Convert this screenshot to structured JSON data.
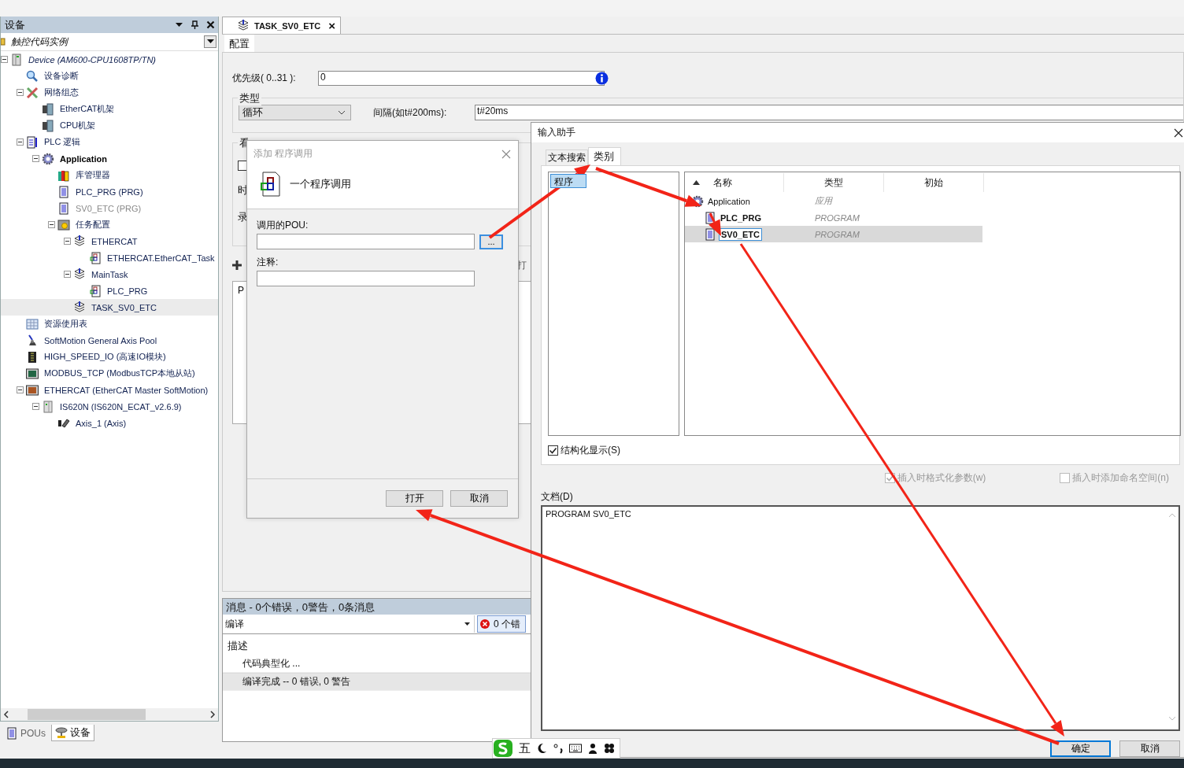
{
  "device_panel": {
    "title": "设备",
    "project": "触控代码实例",
    "tree": [
      {
        "text": "Device (AM600-CPU1608TP/TN)",
        "kind": "device",
        "italic": true,
        "bold": false,
        "greyed": false,
        "selected": false,
        "expanded": true,
        "children": [
          {
            "text": "设备诊断",
            "kind": "diag",
            "italic": false,
            "bold": false,
            "greyed": false,
            "selected": false
          },
          {
            "text": "网络组态",
            "kind": "network",
            "italic": false,
            "bold": false,
            "greyed": false,
            "selected": false,
            "expanded": true,
            "children": [
              {
                "text": "EtherCAT机架",
                "kind": "rack",
                "italic": false,
                "bold": false,
                "greyed": false,
                "selected": false
              },
              {
                "text": "CPU机架",
                "kind": "rack",
                "italic": false,
                "bold": false,
                "greyed": false,
                "selected": false
              }
            ]
          },
          {
            "text": "PLC 逻辑",
            "kind": "plc",
            "italic": false,
            "bold": false,
            "greyed": false,
            "selected": false,
            "expanded": true,
            "children": [
              {
                "text": "Application",
                "kind": "application",
                "italic": false,
                "bold": true,
                "greyed": false,
                "selected": false,
                "expanded": true,
                "children": [
                  {
                    "text": "库管理器",
                    "kind": "library",
                    "italic": false,
                    "bold": false,
                    "greyed": false,
                    "selected": false
                  },
                  {
                    "text": "PLC_PRG (PRG)",
                    "kind": "pou",
                    "italic": false,
                    "bold": false,
                    "greyed": false,
                    "selected": false
                  },
                  {
                    "text": "SV0_ETC (PRG)",
                    "kind": "pou",
                    "italic": false,
                    "bold": false,
                    "greyed": true,
                    "selected": false
                  },
                  {
                    "text": "任务配置",
                    "kind": "taskconfig",
                    "italic": false,
                    "bold": false,
                    "greyed": false,
                    "selected": false,
                    "expanded": true,
                    "children": [
                      {
                        "text": "ETHERCAT",
                        "kind": "task",
                        "italic": false,
                        "bold": false,
                        "greyed": false,
                        "selected": false,
                        "expanded": true,
                        "children": [
                          {
                            "text": "ETHERCAT.EtherCAT_Task",
                            "kind": "call",
                            "italic": false,
                            "bold": false,
                            "greyed": false,
                            "selected": false
                          }
                        ]
                      },
                      {
                        "text": "MainTask",
                        "kind": "task",
                        "italic": false,
                        "bold": false,
                        "greyed": false,
                        "selected": false,
                        "expanded": true,
                        "children": [
                          {
                            "text": "PLC_PRG",
                            "kind": "call",
                            "italic": false,
                            "bold": false,
                            "greyed": false,
                            "selected": false
                          }
                        ]
                      },
                      {
                        "text": "TASK_SV0_ETC",
                        "kind": "task",
                        "italic": false,
                        "bold": false,
                        "greyed": false,
                        "selected": true
                      }
                    ]
                  }
                ]
              }
            ]
          },
          {
            "text": "资源使用表",
            "kind": "table",
            "italic": false,
            "bold": false,
            "greyed": false,
            "selected": false
          },
          {
            "text": "SoftMotion General Axis Pool",
            "kind": "axispool",
            "italic": false,
            "bold": false,
            "greyed": false,
            "selected": false
          },
          {
            "text": "HIGH_SPEED_IO (高速IO模块)",
            "kind": "io",
            "italic": false,
            "bold": false,
            "greyed": false,
            "selected": false
          },
          {
            "text": "MODBUS_TCP (ModbusTCP本地从站)",
            "kind": "modbus",
            "italic": false,
            "bold": false,
            "greyed": false,
            "selected": false
          },
          {
            "text": "ETHERCAT (EtherCAT Master SoftMotion)",
            "kind": "ethercat",
            "italic": false,
            "bold": false,
            "greyed": false,
            "selected": false,
            "expanded": true,
            "children": [
              {
                "text": "IS620N (IS620N_ECAT_v2.6.9)",
                "kind": "drive",
                "italic": false,
                "bold": false,
                "greyed": false,
                "selected": false,
                "expanded": true,
                "children": [
                  {
                    "text": "Axis_1 (Axis)",
                    "kind": "axis",
                    "italic": false,
                    "bold": false,
                    "greyed": false,
                    "selected": false
                  }
                ]
              }
            ]
          }
        ]
      }
    ],
    "tabs": [
      {
        "label": "POUs",
        "kind": "pou",
        "selected": false
      },
      {
        "label": "设备",
        "kind": "devices",
        "selected": true
      }
    ]
  },
  "editor": {
    "tab": {
      "title": "TASK_SV0_ETC",
      "close": "×"
    },
    "subtabs": [
      {
        "label": "配置",
        "selected": true
      }
    ],
    "priority": {
      "label": "优先级( 0..31 ):",
      "value": "0"
    },
    "type_group": {
      "legend": "类型",
      "type_value": "循环",
      "interval_label": "间隔(如t#200ms):",
      "interval_value": "t#20ms"
    },
    "watchdog_group": {
      "legend": "看",
      "checked": false,
      "labels": [
        "时",
        "录"
      ]
    },
    "toolbar": {
      "button_fragment": "打"
    },
    "call_list": {
      "fragment": "P"
    }
  },
  "messages": {
    "title": "消息 - 0个错误，0警告，0条消息",
    "source": "编译",
    "error_button": "0 个错",
    "column": "描述",
    "rows": [
      {
        "text": "代码典型化 ...",
        "selected": false
      },
      {
        "text": "编译完成 -- 0 错误, 0 警告",
        "selected": true
      }
    ]
  },
  "add_call_dialog": {
    "title": "添加 程序调用",
    "active": false,
    "header": "一个程序调用",
    "fields": [
      {
        "label": "调用的POU:",
        "browse": "..."
      },
      {
        "label": "注释:"
      }
    ],
    "buttons": [
      {
        "label": "打开",
        "default": false
      },
      {
        "label": "取消",
        "default": false
      }
    ]
  },
  "input_assistant": {
    "title": "输入助手",
    "tabs": [
      {
        "label": "文本搜索",
        "selected": false
      },
      {
        "label": "类别",
        "selected": true
      }
    ],
    "categories": [
      {
        "label": "程序",
        "selected": true
      }
    ],
    "columns": [
      "名称",
      "类型",
      "初始"
    ],
    "items": [
      {
        "name": "Application",
        "type": "应用",
        "kind": "application",
        "bold": false,
        "selected": false,
        "children": [
          {
            "name": "PLC_PRG",
            "type": "PROGRAM",
            "kind": "pou",
            "bold": true,
            "selected": false
          },
          {
            "name": "SV0_ETC",
            "type": "PROGRAM",
            "kind": "pou",
            "bold": true,
            "selected": true
          }
        ]
      }
    ],
    "structured": {
      "label": "结构化显示(S)",
      "checked": true,
      "disabled": false
    },
    "insert_options": [
      {
        "label": "插入时格式化参数(w)",
        "checked": true,
        "disabled": true
      },
      {
        "label": "插入时添加命名空间(n)",
        "checked": false,
        "disabled": true
      }
    ],
    "doc_label": "文档(D)",
    "doc_text": "PROGRAM SV0_ETC",
    "buttons": [
      {
        "label": "确定",
        "default": true
      },
      {
        "label": "取消",
        "default": false
      }
    ]
  },
  "ime_bar": {
    "mode": "五"
  }
}
